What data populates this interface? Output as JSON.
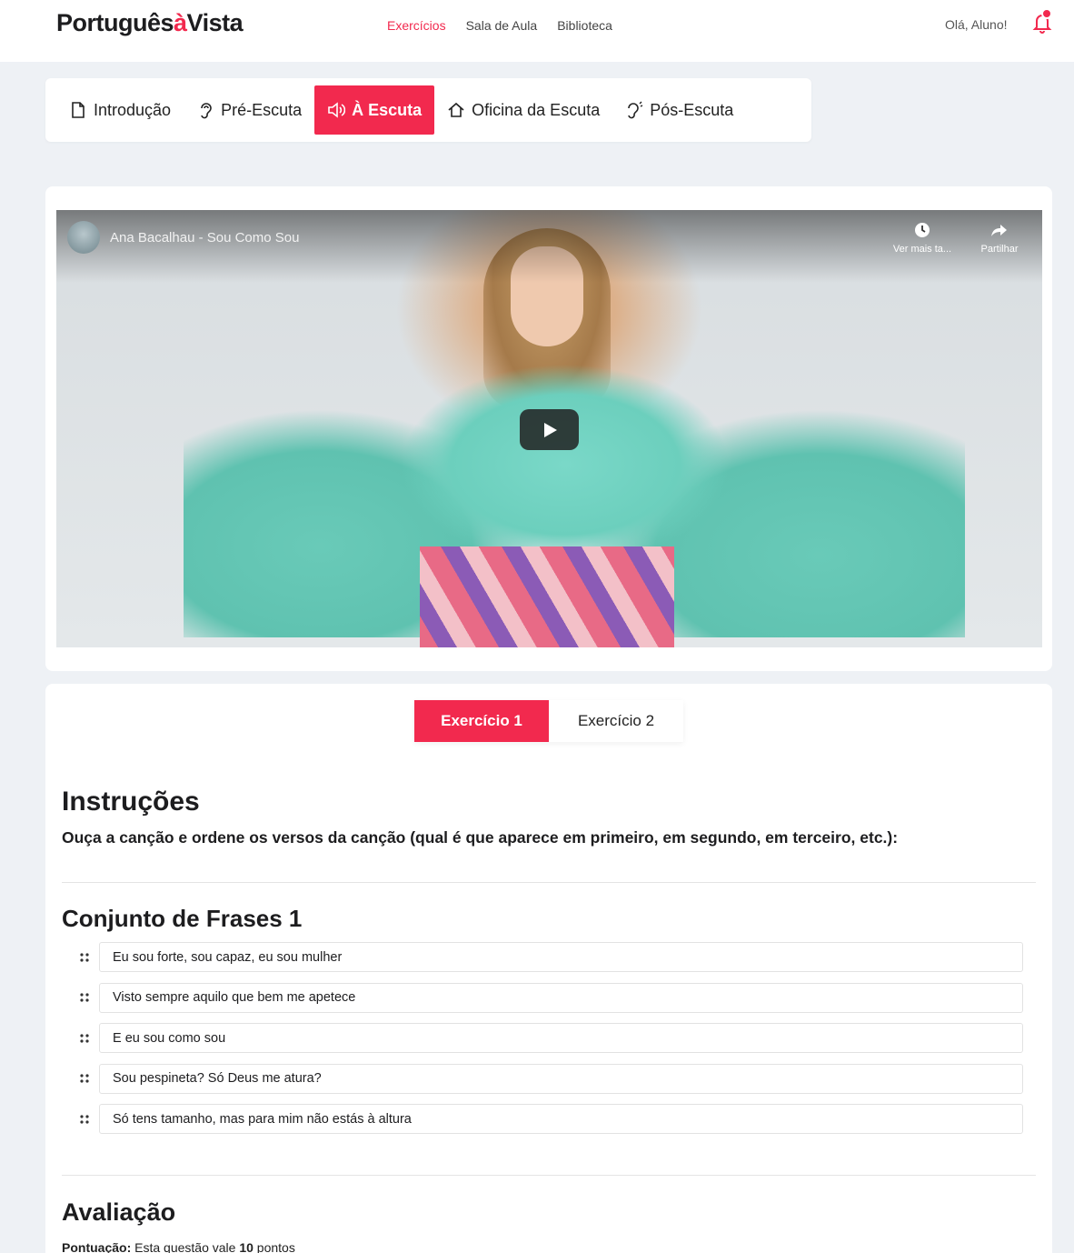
{
  "header": {
    "logo_main": "Português",
    "logo_accent": "à",
    "logo_end": "Vista",
    "nav": [
      {
        "label": "Exercícios",
        "active": true
      },
      {
        "label": "Sala de Aula",
        "active": false
      },
      {
        "label": "Biblioteca",
        "active": false
      }
    ],
    "greeting": "Olá, Aluno!",
    "accent_color": "#f2294e"
  },
  "steps": [
    {
      "label": "Introdução",
      "icon": "document-icon"
    },
    {
      "label": "Pré-Escuta",
      "icon": "ear-icon"
    },
    {
      "label": "À Escuta",
      "icon": "speaker-icon",
      "active": true
    },
    {
      "label": "Oficina da Escuta",
      "icon": "home-icon"
    },
    {
      "label": "Pós-Escuta",
      "icon": "ear-sound-icon"
    }
  ],
  "video": {
    "title": "Ana Bacalhau - Sou Como Sou",
    "watch_later": "Ver mais ta...",
    "share": "Partilhar"
  },
  "exercise_tabs": [
    {
      "label": "Exercício 1",
      "active": true
    },
    {
      "label": "Exercício 2",
      "active": false
    }
  ],
  "instructions": {
    "heading": "Instruções",
    "text": "Ouça a canção e ordene os versos da canção (qual é que aparece em primeiro, em segundo, em terceiro, etc.):"
  },
  "sentence_set": {
    "heading": "Conjunto de Frases 1",
    "items": [
      "Eu sou forte, sou capaz, eu sou mulher",
      "Visto sempre aquilo que bem me apetece",
      "E eu sou como sou",
      "Sou pespineta? Só Deus me atura?",
      "Só tens tamanho, mas para mim não estás à altura"
    ]
  },
  "evaluation": {
    "heading": "Avaliação",
    "score_label": "Pontuação:",
    "score_text_pre": "Esta questão vale",
    "score_points": "10",
    "score_text_post": "pontos"
  }
}
